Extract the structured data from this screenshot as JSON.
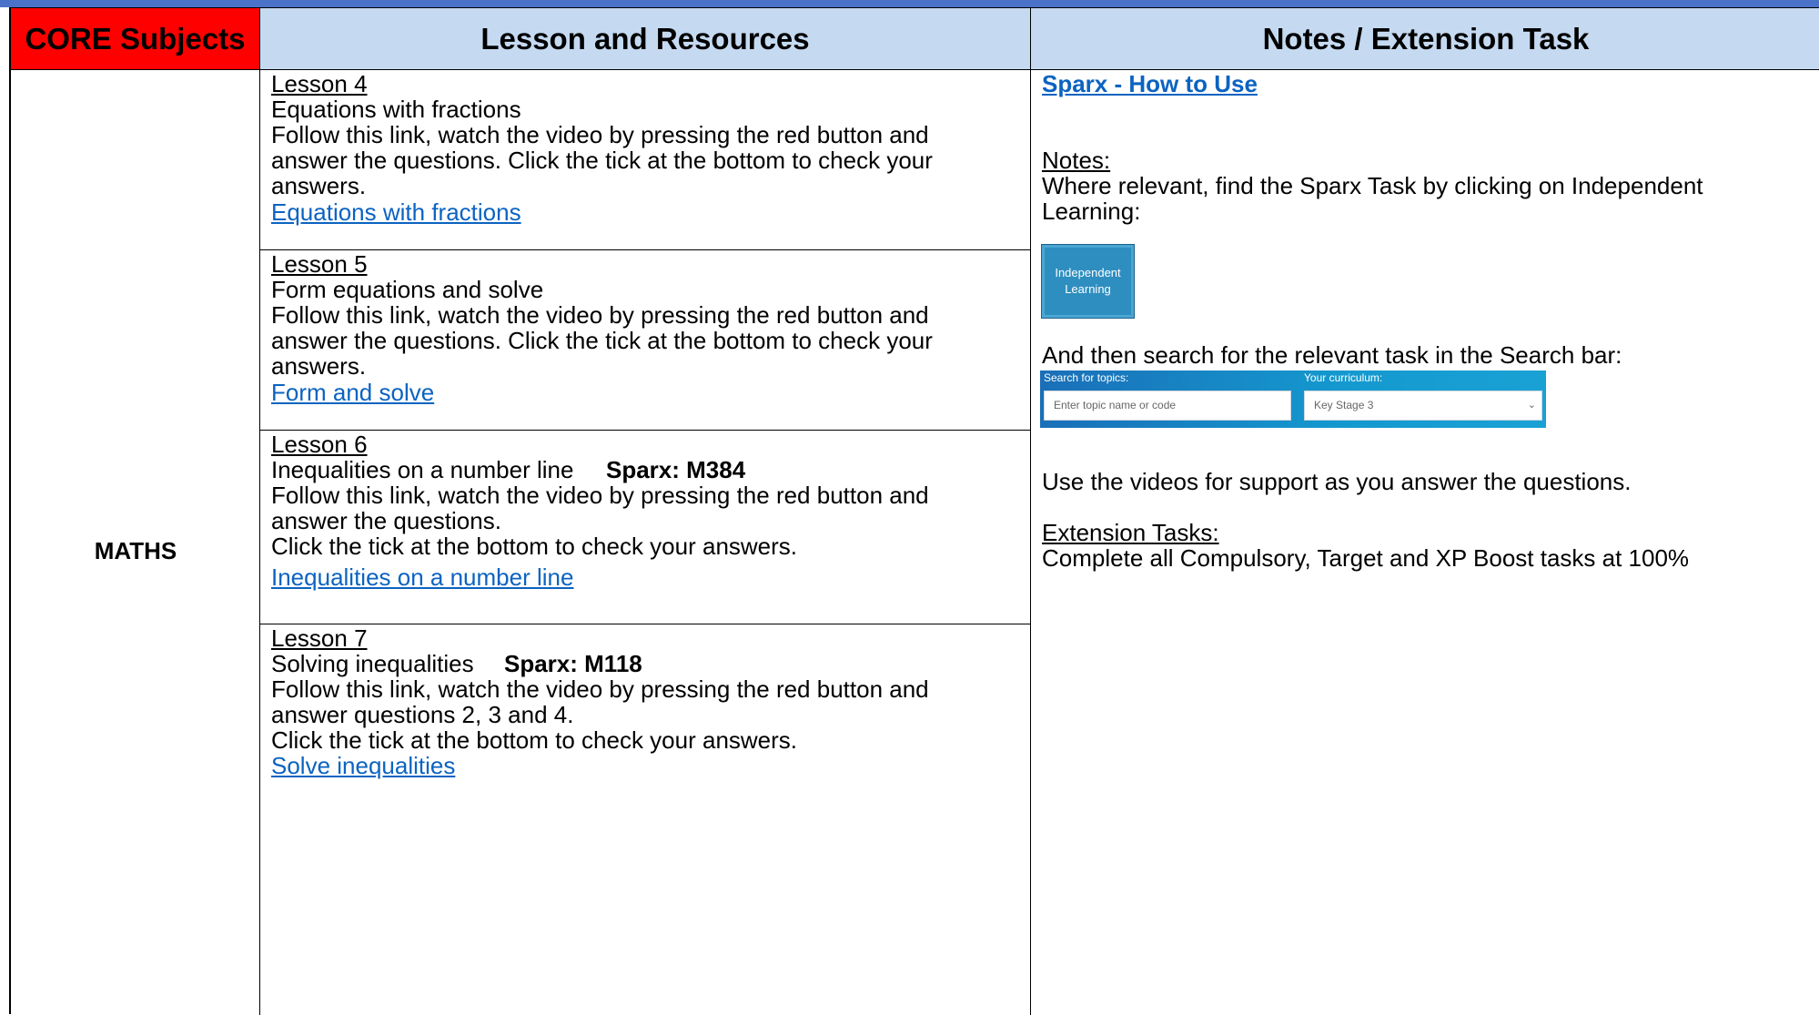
{
  "header": {
    "col1": "CORE Subjects",
    "col2": "Lesson and Resources",
    "col3": "Notes / Extension Task"
  },
  "subject": "MATHS",
  "lessons": [
    {
      "lesson": "Lesson 4",
      "title": "Equations with fractions",
      "lines": [
        "Follow this link, watch the video by pressing the red button and",
        "answer the questions. Click the tick at the bottom to check your",
        "answers."
      ],
      "link": "Equations with fractions"
    },
    {
      "lesson": "Lesson 5",
      "title": "Form equations and solve",
      "lines": [
        "Follow this link, watch the video by pressing the red button and",
        "answer the questions. Click the tick at the bottom to check your",
        "answers."
      ],
      "link": "Form and solve"
    },
    {
      "lesson": "Lesson 6",
      "title": "Inequalities on a number line",
      "sparx": "Sparx: M384",
      "lines": [
        "Follow this link, watch the video by pressing the red button and",
        "answer the questions.",
        "Click the tick at the bottom to check your answers."
      ],
      "link": "Inequalities on a number line"
    },
    {
      "lesson": "Lesson 7",
      "title": "Solving inequalities",
      "sparx": "Sparx: M118",
      "lines": [
        "Follow this link, watch the video by pressing the red button and",
        "answer questions 2, 3 and 4.",
        "Click the tick at the bottom to check your answers."
      ],
      "link": "Solve inequalities"
    }
  ],
  "notes": {
    "sparx_link": "Sparx - How to Use",
    "notes_heading": "Notes:",
    "notes_line1": "Where relevant, find the Sparx Task by clicking on Independent",
    "notes_line2": "Learning:",
    "indep_button": {
      "line1": "Independent",
      "line2": "Learning"
    },
    "search_line": "And then search for the relevant task in the Search bar:",
    "search_bar": {
      "topics_label": "Search for topics:",
      "topics_placeholder": "Enter topic name or code",
      "curriculum_label": "Your curriculum:",
      "curriculum_value": "Key Stage 3"
    },
    "videos_line": "Use the videos for support as you answer the questions.",
    "ext_heading": "Extension Tasks:",
    "ext_line": "Complete all Compulsory, Target and XP Boost tasks at 100%"
  },
  "colors": {
    "core_header": "#ff0000",
    "header_bg": "#c5daf1",
    "link": "#0b63c1",
    "top_bar": "#4a72c8"
  }
}
